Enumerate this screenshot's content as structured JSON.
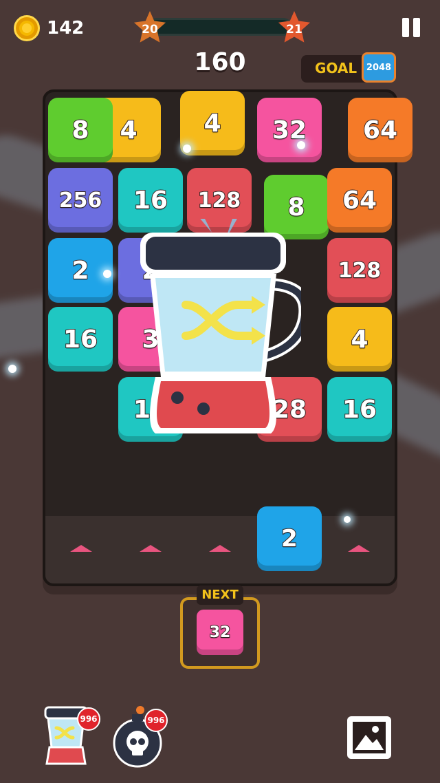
{
  "hud": {
    "coins": "142",
    "level_current": "20",
    "level_next": "21",
    "score": "160",
    "goal_label": "GOAL",
    "goal_value": "2048"
  },
  "board": {
    "tiles": [
      {
        "value": "4",
        "color": "#f6bb1a"
      },
      {
        "value": "8",
        "color": "#5fcc2f"
      },
      {
        "value": "4",
        "color": "#f6bb1a"
      },
      {
        "value": "32",
        "color": "#f5549f"
      },
      {
        "value": "64",
        "color": "#f57a28"
      },
      {
        "value": "256",
        "color": "#6c6ee0"
      },
      {
        "value": "16",
        "color": "#1fc7c2"
      },
      {
        "value": "128",
        "color": "#e24f57"
      },
      {
        "value": "8",
        "color": "#5fcc2f"
      },
      {
        "value": "64",
        "color": "#f57a28"
      },
      {
        "value": "2",
        "color": "#1fa4e8"
      },
      {
        "value": "2",
        "color": "#6c6ee0"
      },
      {
        "value": "128",
        "color": "#e24f57"
      },
      {
        "value": "16",
        "color": "#1fc7c2"
      },
      {
        "value": "3",
        "color": "#f5549f"
      },
      {
        "value": "4",
        "color": "#f6bb1a"
      },
      {
        "value": "16",
        "color": "#1fc7c2"
      },
      {
        "value": "28",
        "color": "#e24f57"
      },
      {
        "value": "16",
        "color": "#1fc7c2"
      },
      {
        "value": "2",
        "color": "#1fa4e8"
      }
    ]
  },
  "next": {
    "label": "NEXT",
    "value": "32",
    "color": "#f5549f"
  },
  "boosters": {
    "shuffle_count": "996",
    "bomb_count": "996"
  }
}
